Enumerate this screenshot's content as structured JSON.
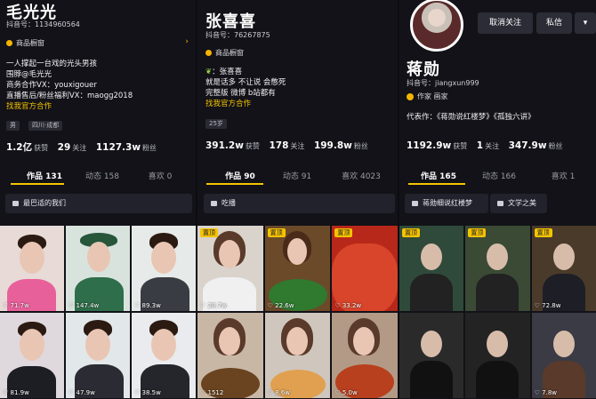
{
  "p1": {
    "name": "毛光光",
    "uid": "抖音号：1134960564",
    "shop": "商品橱窗",
    "bio": [
      "一人撑起一台戏的光头男孩",
      "围脖@毛光光",
      "商务合作VX：youxigouer",
      "直播售后/粉丝福利VX：maogg2018"
    ],
    "bio_link": "找我官方合作",
    "tags": [
      "男",
      "四川·成都"
    ],
    "stats": {
      "likes": "1.2亿",
      "likes_label": "获赞",
      "follow": "29",
      "follow_label": "关注",
      "fans": "1127.3w",
      "fans_label": "粉丝"
    },
    "tabs": [
      "作品 131",
      "动态 158",
      "喜欢 0"
    ],
    "chip": "最巴适的我们",
    "cells": [
      "71.7w",
      "147.4w",
      "89.3w",
      "81.9w",
      "47.9w",
      "38.5w"
    ]
  },
  "p2": {
    "name": "张喜喜",
    "uid": "抖音号：76267875",
    "shop": "商品橱窗",
    "bio": [
      "：张喜喜",
      "就是话多 不让说 会憋死",
      "完整版 微博 b站都有"
    ],
    "bio_link": "找我官方合作",
    "tags": [
      "25岁"
    ],
    "stats": {
      "likes": "391.2w",
      "likes_label": "获赞",
      "follow": "178",
      "follow_label": "关注",
      "fans": "199.8w",
      "fans_label": "粉丝"
    },
    "tabs": [
      "作品 90",
      "动态 91",
      "喜欢 4023"
    ],
    "chip": "吃播",
    "pin": "置顶",
    "cells": [
      "28.7w",
      "22.6w",
      "33.2w",
      "1512",
      "8.6w",
      "5.0w"
    ]
  },
  "p3": {
    "name": "蒋勋",
    "uid": "抖音号：jiangxun999",
    "author": "作家 画家",
    "btn_unfollow": "取消关注",
    "btn_msg": "私信",
    "works": "代表作：《蒋勋说红楼梦》《孤独六讲》",
    "stats": {
      "likes": "1192.9w",
      "likes_label": "获赞",
      "follow": "1",
      "follow_label": "关注",
      "fans": "347.9w",
      "fans_label": "粉丝"
    },
    "tabs": [
      "作品 165",
      "动态 166",
      "喜欢 1"
    ],
    "chips": [
      "蒋勋细说红楼梦",
      "文学之美"
    ],
    "pin": "置顶",
    "cells": [
      "",
      "",
      "72.8w",
      "",
      "",
      "7.8w"
    ]
  }
}
